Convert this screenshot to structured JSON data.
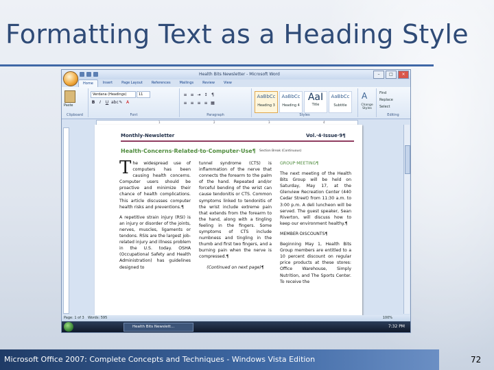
{
  "slide": {
    "title": "Formatting Text as a Heading Style",
    "footer": "Microsoft Office 2007: Complete Concepts and Techniques - Windows Vista Edition",
    "page_number": "72"
  },
  "window": {
    "title": "Health Bits Newsletter - Microsoft Word",
    "tabs": [
      "Home",
      "Insert",
      "Page Layout",
      "References",
      "Mailings",
      "Review",
      "View"
    ],
    "active_tab": "Home"
  },
  "ribbon": {
    "clipboard_label": "Clipboard",
    "paste_label": "Paste",
    "font_label": "Font",
    "paragraph_label": "Paragraph",
    "styles_label": "Styles",
    "editing_label": "Editing",
    "font_name": "Verdana (Headings)",
    "font_size": "11",
    "bold": "B",
    "italic": "I",
    "underline": "U",
    "styles": [
      {
        "sample": "AaBbCc",
        "name": "Heading 3"
      },
      {
        "sample": "AaBbCc",
        "name": "Heading 4"
      },
      {
        "sample": "AaI",
        "name": "Title"
      },
      {
        "sample": "AaBbCc",
        "name": "Subtitle"
      }
    ],
    "change_styles": "Change Styles",
    "find": "Find",
    "replace": "Replace",
    "select": "Select"
  },
  "document": {
    "header_left": "Monthly-Newsletter",
    "header_right": "Vol.·4·Issue·9¶",
    "heading": "Health·Concerns·Related·to·Computer·Use¶",
    "section_break": "Section Break (Continuous)",
    "col1_dropcap": "T",
    "col1_p1": "he widespread use of computers has been causing health concerns. Computer users should be proactive and minimize their chance of health complications. This article discusses computer health risks and preventions.¶",
    "col1_p2": "A repetitive strain injury (RSI) is an injury or disorder of the joints, nerves, muscles, ligaments or tendons. RSIs are the largest job-related injury and illness problem in the U.S. today. OSHA (Occupational Safety and Health Administration) has guidelines designed to",
    "col2_p1": "tunnel syndrome (CTS) is inflammation of the nerve that connects the forearm to the palm of the hand. Repeated and/or forceful bending of the wrist can cause tendonitis or CTS. Common symptoms linked to tendonitis of the wrist include extreme pain that extends from the forearm to the hand, along with a tingling feeling in the fingers. Some symptoms of CTS include numbness and tingling in the thumb and first two fingers, and a burning pain when the nerve is compressed.¶",
    "col2_cont": "(Continued on next page)¶",
    "col3_h1": "GROUP·MEETING¶",
    "col3_p1": "The next meeting of the Health Bits Group will be held on Saturday, May 17, at the Glenview Recreation Center (440 Cedar Street) from 11:30 a.m. to 3:00 p.m. A deli luncheon will be served. The guest speaker, Sean Riverton, will discuss how to keep our environment healthy.¶",
    "col3_h2": "MEMBER·DISCOUNTS¶",
    "col3_p2": "Beginning May 1, Health Bits Group members are entitled to a 10 percent discount on regular price products at these stores: Office Warehouse, Simply Nutrition, and The Sports Center. To receive the"
  },
  "status": {
    "page": "Page: 1 of 3",
    "words": "Words: 595",
    "zoom": "100%"
  },
  "taskbar": {
    "item": "Health Bits Newslett...",
    "clock": "7:32 PM"
  },
  "colors": {
    "title": "#2f4b77",
    "heading": "#4e8b3c",
    "accent_rule": "#8f3c5f",
    "footer": "#2f5592"
  }
}
